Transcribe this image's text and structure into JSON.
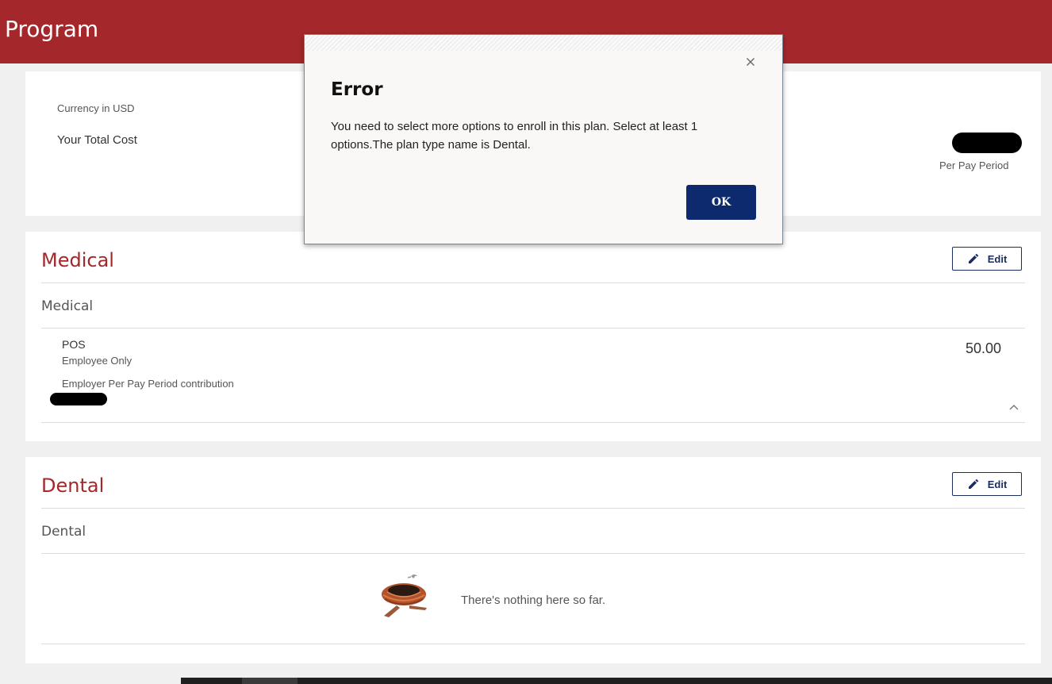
{
  "header": {
    "title": "Program",
    "color": "#a4282b"
  },
  "summary": {
    "currency_label": "Currency in USD",
    "total_cost_label": "Your Total Cost",
    "per_pay_period_label": "Per Pay Period"
  },
  "medical": {
    "title": "Medical",
    "edit_label": "Edit",
    "subtitle": "Medical",
    "plan": {
      "name": "POS",
      "coverage": "Employee Only",
      "cost": "50.00",
      "employer_contribution_label": "Employer Per Pay Period contribution"
    }
  },
  "dental": {
    "title": "Dental",
    "edit_label": "Edit",
    "subtitle": "Dental",
    "empty_message": "There's nothing here so far."
  },
  "dialog": {
    "title": "Error",
    "message": "You need to select more options to enroll in this plan. Select at least 1 options.The plan type name is Dental.",
    "ok_label": "OK",
    "ok_color": "#0e2a6e"
  },
  "icons": {
    "edit": "pencil-icon",
    "collapse": "chevron-up-icon",
    "close": "close-icon",
    "empty": "empty-nest-icon"
  }
}
